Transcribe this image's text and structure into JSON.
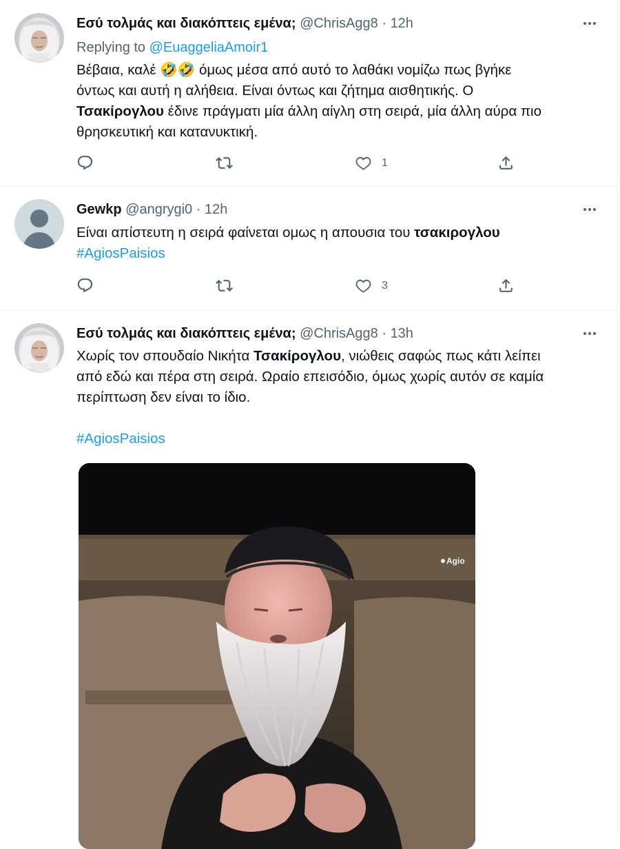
{
  "tweets": [
    {
      "name": "Εσύ τολμάς και διακόπτεις εμένα;",
      "handle": "@ChrisAgg8",
      "separator": "·",
      "time": "12h",
      "replying_prefix": "Replying to",
      "replying_to": "@EuaggeliaAmoir1",
      "text": {
        "line1_pre": "Βέβαια, καλέ",
        "emoji": "🤣🤣",
        "line1_post": "όμως μέσα από αυτό το λαθάκι νομίζω πως βγήκε",
        "line2": "όντως και αυτή η αλήθεια. Είναι όντως και ζήτημα αισθητικής. Ο",
        "line3_bold": "Τσακίρογλου",
        "line3_rest": "έδινε πράγματι μία άλλη αίγλη στη σειρά, μία άλλη αύρα πιο",
        "line4": "θρησκευτική και κατανυκτική."
      },
      "likes": "1",
      "more_icon": "more-horizontal-icon"
    },
    {
      "name": "Gewkp",
      "handle": "@angrygi0",
      "separator": "·",
      "time": "12h",
      "text": {
        "line1_pre": "Είναι απίστευτη η σειρά φαίνεται ομως η απουσια του",
        "line1_bold": "τσακιρογλου",
        "hashtag": "#AgiosPaisios"
      },
      "likes": "3",
      "more_icon": "more-horizontal-icon"
    },
    {
      "name": "Εσύ τολμάς και διακόπτεις εμένα;",
      "handle": "@ChrisAgg8",
      "separator": "·",
      "time": "13h",
      "text": {
        "line1_pre": "Χωρίς τον σπουδαίο Νικήτα",
        "line1_bold": "Τσακίρογλου",
        "line1_post": ", νιώθεις σαφώς πως κάτι λείπει",
        "line2": "από εδώ και πέρα στη σειρά. Ωραίο επεισόδιο, όμως χωρίς αυτόν σε καμία",
        "line3": "περίπτωση δεν είναι το ίδιο.",
        "hashtag": "#AgiosPaisios"
      },
      "media_overlay_text": "Agio",
      "more_icon": "more-horizontal-icon"
    }
  ],
  "icons": {
    "reply": "reply-icon",
    "retweet": "retweet-icon",
    "like": "heart-icon",
    "share": "share-icon"
  },
  "colors": {
    "link": "#1d9bf0",
    "secondary": "#536471",
    "text": "#0f1419",
    "divider": "#eff3f4"
  }
}
